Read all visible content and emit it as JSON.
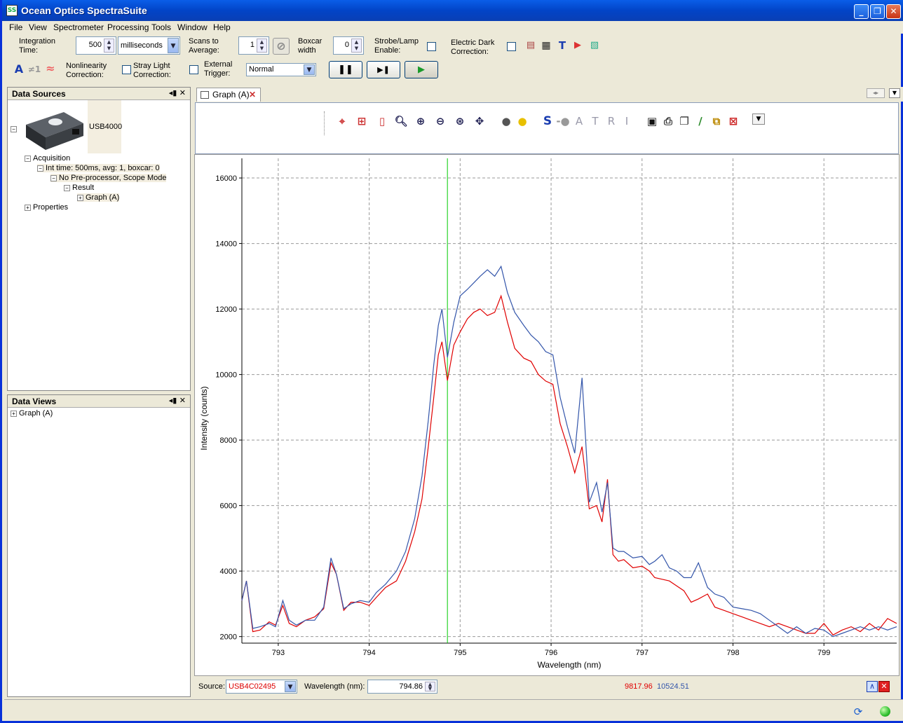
{
  "window": {
    "title": "Ocean Optics SpectraSuite",
    "minimize": "_",
    "restore": "❐",
    "close": "✕"
  },
  "menu": [
    "File",
    "View",
    "Spectrometer",
    "Processing",
    "Tools",
    "Window",
    "Help"
  ],
  "toolbar": {
    "integration_label": "Integration\nTime:",
    "integration_value": "500",
    "integration_unit": "milliseconds",
    "scans_label": "Scans to\nAverage:",
    "scans_value": "1",
    "boxcar_label": "Boxcar\nwidth",
    "boxcar_value": "0",
    "strobe_label": "Strobe/Lamp\nEnable:",
    "dark_label": "Electric Dark\nCorrection:",
    "nonlin_label": "Nonlinearity\nCorrection:",
    "stray_label": "Stray Light\nCorrection:",
    "ext_label": "External\nTrigger:",
    "trigger_value": "Normal",
    "a_glyph": "A",
    "neq_glyph": "≠1"
  },
  "data_sources": {
    "title": "Data Sources",
    "device": "USB4000",
    "acquisition": "Acquisition",
    "int_time": "Int time: 500ms, avg: 1, boxcar: 0",
    "preprocessor": "No Pre-processor, Scope Mode",
    "result": "Result",
    "graph": "Graph (A)",
    "properties": "Properties"
  },
  "data_views": {
    "title": "Data Views",
    "graph": "Graph (A)"
  },
  "graph_tab": {
    "label": "Graph (A)"
  },
  "graph_toolbar_letters": {
    "s": "S",
    "a": "A",
    "t": "T",
    "r": "R",
    "i": "I"
  },
  "status": {
    "source_label": "Source:",
    "source_value": "USB4C02495",
    "wavelength_label": "Wavelength (nm):",
    "wavelength_value": "794.86",
    "red_value": "9817.96",
    "blue_value": "10524.51"
  },
  "colors": {
    "series_red": "#e00000",
    "series_blue": "#3355aa",
    "cursor": "#00cc00"
  },
  "chart_data": {
    "type": "line",
    "xlabel": "Wavelength (nm)",
    "ylabel": "Intensity (counts)",
    "xlim": [
      792.6,
      799.8
    ],
    "ylim": [
      1800,
      16600
    ],
    "xticks": [
      793,
      794,
      795,
      796,
      797,
      798,
      799
    ],
    "yticks": [
      2000,
      4000,
      6000,
      8000,
      10000,
      12000,
      14000,
      16000
    ],
    "grid": true,
    "cursor_x": 794.86,
    "series": [
      {
        "color": "#e00000",
        "x": [
          792.6,
          792.65,
          792.72,
          792.8,
          792.9,
          792.97,
          793.05,
          793.12,
          793.2,
          793.3,
          793.4,
          793.5,
          793.58,
          793.64,
          793.72,
          793.8,
          793.9,
          794.0,
          794.08,
          794.18,
          794.3,
          794.4,
          794.5,
          794.58,
          794.65,
          794.71,
          794.76,
          794.8,
          794.86,
          794.93,
          795.0,
          795.08,
          795.15,
          795.22,
          795.3,
          795.38,
          795.45,
          795.52,
          795.6,
          795.7,
          795.78,
          795.86,
          795.94,
          796.02,
          796.1,
          796.18,
          796.26,
          796.34,
          796.42,
          796.5,
          796.56,
          796.62,
          796.68,
          796.74,
          796.8,
          796.9,
          797.0,
          797.08,
          797.14,
          797.22,
          797.3,
          797.38,
          797.46,
          797.54,
          797.62,
          797.72,
          797.8,
          797.9,
          798.0,
          798.1,
          798.2,
          798.3,
          798.4,
          798.5,
          798.6,
          798.7,
          798.8,
          798.9,
          799.0,
          799.1,
          799.2,
          799.3,
          799.4,
          799.5,
          799.6,
          799.7,
          799.8
        ],
        "y": [
          3100,
          3700,
          2150,
          2200,
          2450,
          2350,
          2950,
          2400,
          2300,
          2500,
          2600,
          2850,
          4250,
          3900,
          2800,
          3050,
          3050,
          2950,
          3200,
          3500,
          3700,
          4300,
          5200,
          6200,
          7800,
          9300,
          10600,
          11000,
          9817,
          10900,
          11300,
          11700,
          11900,
          12000,
          11800,
          11900,
          12400,
          11600,
          10800,
          10500,
          10400,
          10000,
          9800,
          9700,
          8500,
          7800,
          7000,
          7800,
          5900,
          6000,
          5500,
          6800,
          4500,
          4300,
          4350,
          4100,
          4150,
          4000,
          3800,
          3750,
          3700,
          3550,
          3400,
          3050,
          3150,
          3300,
          2900,
          2800,
          2700,
          2600,
          2500,
          2400,
          2300,
          2400,
          2300,
          2200,
          2100,
          2100,
          2400,
          2050,
          2200,
          2300,
          2150,
          2400,
          2200,
          2550,
          2400
        ]
      },
      {
        "color": "#3355aa",
        "x": [
          792.6,
          792.65,
          792.72,
          792.8,
          792.9,
          792.97,
          793.05,
          793.12,
          793.2,
          793.3,
          793.4,
          793.5,
          793.58,
          793.64,
          793.72,
          793.8,
          793.9,
          794.0,
          794.08,
          794.18,
          794.3,
          794.4,
          794.5,
          794.58,
          794.65,
          794.71,
          794.76,
          794.8,
          794.86,
          794.93,
          795.0,
          795.08,
          795.15,
          795.22,
          795.3,
          795.38,
          795.45,
          795.52,
          795.6,
          795.7,
          795.78,
          795.86,
          795.94,
          796.02,
          796.1,
          796.18,
          796.26,
          796.34,
          796.42,
          796.5,
          796.56,
          796.62,
          796.68,
          796.74,
          796.8,
          796.9,
          797.0,
          797.08,
          797.14,
          797.22,
          797.3,
          797.38,
          797.46,
          797.54,
          797.62,
          797.72,
          797.8,
          797.9,
          798.0,
          798.1,
          798.2,
          798.3,
          798.4,
          798.5,
          798.6,
          798.7,
          798.8,
          798.9,
          799.0,
          799.1,
          799.2,
          799.3,
          799.4,
          799.5,
          799.6,
          799.7,
          799.8
        ],
        "y": [
          3100,
          3700,
          2250,
          2300,
          2400,
          2300,
          3100,
          2500,
          2350,
          2500,
          2500,
          2900,
          4400,
          3900,
          2850,
          3000,
          3100,
          3050,
          3350,
          3600,
          4000,
          4600,
          5600,
          6900,
          8600,
          10300,
          11500,
          12000,
          10524,
          11600,
          12400,
          12600,
          12800,
          13000,
          13200,
          13000,
          13300,
          12500,
          11900,
          11500,
          11200,
          11000,
          10700,
          10600,
          9300,
          8400,
          7600,
          9900,
          6100,
          6700,
          5800,
          6700,
          4700,
          4600,
          4600,
          4400,
          4450,
          4200,
          4300,
          4500,
          4100,
          4000,
          3800,
          3800,
          4250,
          3500,
          3300,
          3200,
          2900,
          2850,
          2800,
          2700,
          2500,
          2300,
          2100,
          2300,
          2100,
          2250,
          2200,
          2000,
          2100,
          2200,
          2300,
          2200,
          2300,
          2200,
          2300
        ]
      }
    ]
  }
}
